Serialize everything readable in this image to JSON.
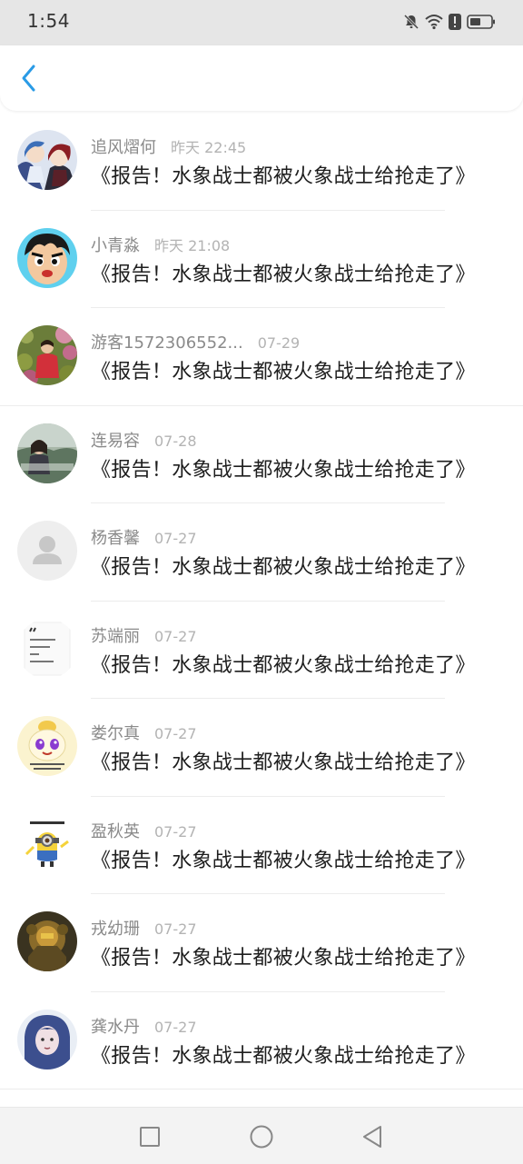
{
  "status_bar": {
    "time": "1:54",
    "icons": [
      "bell-off-icon",
      "wifi-icon",
      "alert-icon",
      "battery-icon"
    ]
  },
  "header": {
    "back_icon": "chevron-left-icon",
    "accent_color": "#2a9be6"
  },
  "comments": [
    {
      "username": "追风熠何",
      "time": "昨天 22:45",
      "text": "《报告！水象战士都被火象战士给抢走了》",
      "avatar": "anime-duo"
    },
    {
      "username": "小青淼",
      "time": "昨天 21:08",
      "text": "《报告！水象战士都被火象战士给抢走了》",
      "avatar": "cartoon-boy"
    },
    {
      "username": "游客1572306552...",
      "time": "07-29",
      "text": "《报告！水象战士都被火象战士给抢走了》",
      "avatar": "photo-flowers"
    },
    {
      "username": "连易容",
      "time": "07-28",
      "text": "《报告！水象战士都被火象战士给抢走了》",
      "avatar": "photo-girl"
    },
    {
      "username": "杨香馨",
      "time": "07-27",
      "text": "《报告！水象战士都被火象战士给抢走了》",
      "avatar": "default-person"
    },
    {
      "username": "苏端丽",
      "time": "07-27",
      "text": "《报告！水象战士都被火象战士给抢走了》",
      "avatar": "text-note"
    },
    {
      "username": "娄尔真",
      "time": "07-27",
      "text": "《报告！水象战士都被火象战士给抢走了》",
      "avatar": "cute-bun"
    },
    {
      "username": "盈秋英",
      "time": "07-27",
      "text": "《报告！水象战士都被火象战士给抢走了》",
      "avatar": "minion"
    },
    {
      "username": "戎幼珊",
      "time": "07-27",
      "text": "《报告！水象战士都被火象战士给抢走了》",
      "avatar": "robot"
    },
    {
      "username": "龚水丹",
      "time": "07-27",
      "text": "《报告！水象战士都被火象战士给抢走了》",
      "avatar": "blue-hair-girl"
    }
  ],
  "nav_bar": {
    "icons": [
      "recent-apps-icon",
      "home-icon",
      "back-triangle-icon"
    ]
  }
}
